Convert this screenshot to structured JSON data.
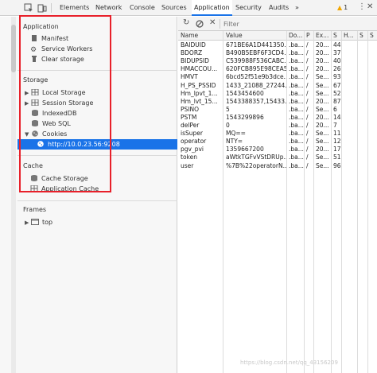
{
  "devtools_tabs": [
    "Elements",
    "Network",
    "Console",
    "Sources",
    "Application",
    "Security",
    "Audits",
    "»"
  ],
  "active_tab": "Application",
  "warnings": {
    "count": "1"
  },
  "sidebar": {
    "application": {
      "title": "Application",
      "items": [
        {
          "label": "Manifest",
          "icon": "manifest-icon"
        },
        {
          "label": "Service Workers",
          "icon": "gear-icon"
        },
        {
          "label": "Clear storage",
          "icon": "trash-icon"
        }
      ]
    },
    "storage": {
      "title": "Storage",
      "items": [
        {
          "label": "Local Storage",
          "icon": "grid-icon",
          "expandable": true,
          "expanded": false
        },
        {
          "label": "Session Storage",
          "icon": "grid-icon",
          "expandable": true,
          "expanded": false
        },
        {
          "label": "IndexedDB",
          "icon": "database-icon",
          "expandable": false
        },
        {
          "label": "Web SQL",
          "icon": "database-icon",
          "expandable": false
        },
        {
          "label": "Cookies",
          "icon": "cookie-icon",
          "expandable": true,
          "expanded": true
        }
      ],
      "cookie_origin": "http://10.0.23.56:9208"
    },
    "cache": {
      "title": "Cache",
      "items": [
        {
          "label": "Cache Storage",
          "icon": "database-icon"
        },
        {
          "label": "Application Cache",
          "icon": "grid-icon"
        }
      ]
    },
    "frames": {
      "title": "Frames",
      "items": [
        {
          "label": "top",
          "icon": "frame-icon"
        }
      ]
    }
  },
  "cookie_toolbar": {
    "filter_placeholder": "Filter"
  },
  "cookie_table": {
    "columns": [
      "Name",
      "Value",
      "Do...",
      "P",
      "Ex...",
      "S",
      "H...",
      "S",
      "S"
    ],
    "rows": [
      [
        "BAIDUID",
        "671BE6A1D441350...",
        ".ba...",
        "/",
        "20...",
        "44",
        "",
        "",
        ""
      ],
      [
        "BDORZ",
        "B490B5EBF6F3CD4...",
        ".ba...",
        "/",
        "20...",
        "37",
        "",
        "",
        ""
      ],
      [
        "BIDUPSID",
        "C539988F536CABC...",
        ".ba...",
        "/",
        "20...",
        "40",
        "",
        "",
        ""
      ],
      [
        "HMACCOU...",
        "620FCB895E98CEA5",
        ".ba...",
        "/",
        "20...",
        "26",
        "",
        "",
        ""
      ],
      [
        "HMVT",
        "6bcd52f51e9b3dce...",
        ".ba...",
        "/",
        "Se...",
        "93",
        "",
        "",
        ""
      ],
      [
        "H_PS_PSSID",
        "1433_21088_27244...",
        ".ba...",
        "/",
        "Se...",
        "67",
        "",
        "",
        ""
      ],
      [
        "Hm_lpvt_1...",
        "1543454600",
        ".ba...",
        "/",
        "Se...",
        "52",
        "",
        "",
        ""
      ],
      [
        "Hm_lvt_15...",
        "1543388357,15433...",
        ".ba...",
        "/",
        "20...",
        "87",
        "",
        "",
        ""
      ],
      [
        "PSINO",
        "5",
        ".ba...",
        "/",
        "Se...",
        "6",
        "",
        "",
        ""
      ],
      [
        "PSTM",
        "1543299896",
        ".ba...",
        "/",
        "20...",
        "14",
        "",
        "",
        ""
      ],
      [
        "delPer",
        "0",
        ".ba...",
        "/",
        "20...",
        "7",
        "",
        "",
        ""
      ],
      [
        "isSuper",
        "MQ==",
        ".ba...",
        "/",
        "Se...",
        "11",
        "",
        "",
        ""
      ],
      [
        "operator",
        "NTY=",
        ".ba...",
        "/",
        "Se...",
        "12",
        "",
        "",
        ""
      ],
      [
        "pgv_pvi",
        "1359667200",
        ".ba...",
        "/",
        "20...",
        "17",
        "",
        "",
        ""
      ],
      [
        "token",
        "aWtkTGFvVStDRUp...",
        ".ba...",
        "/",
        "Se...",
        "51",
        "",
        "",
        ""
      ],
      [
        "user",
        "%7B%22operatorN...",
        ".ba...",
        "/",
        "Se...",
        "96",
        "",
        "",
        ""
      ]
    ]
  },
  "watermark": "https://blog.csdn.net/qq_43156209"
}
